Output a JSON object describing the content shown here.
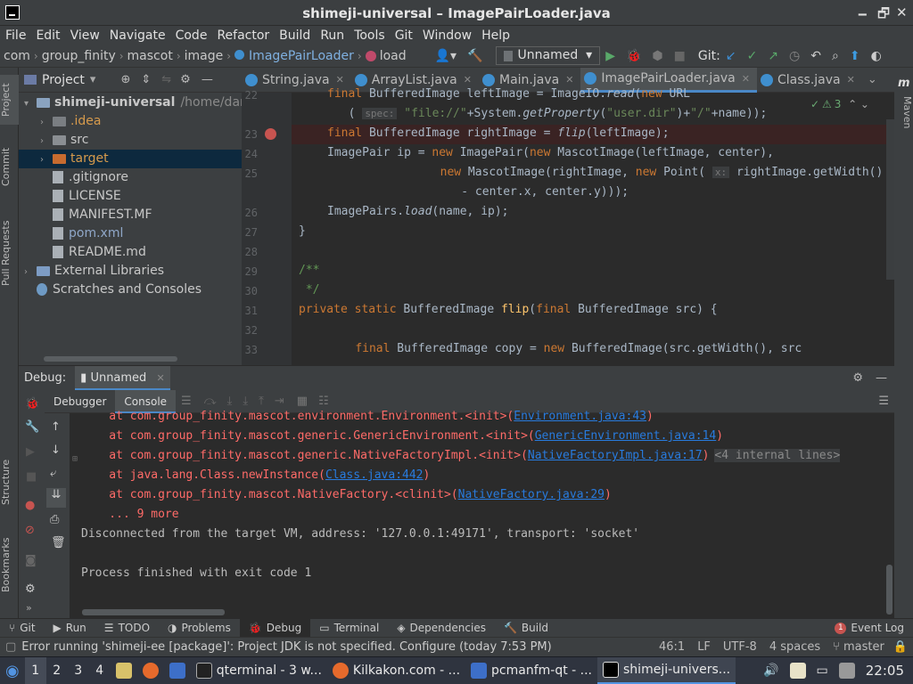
{
  "window": {
    "title": "shimeji-universal – ImagePairLoader.java"
  },
  "menu": [
    "File",
    "Edit",
    "View",
    "Navigate",
    "Code",
    "Refactor",
    "Build",
    "Run",
    "Tools",
    "Git",
    "Window",
    "Help"
  ],
  "breadcrumb": [
    "com",
    "group_finity",
    "mascot",
    "image",
    "ImagePairLoader",
    "load"
  ],
  "toolbar": {
    "run_config": "Unnamed",
    "git_label": "Git:"
  },
  "project": {
    "header": "Project",
    "items": [
      {
        "label": "shimeji-universal",
        "path": "/home/dartz",
        "depth": 0,
        "type": "module"
      },
      {
        "label": ".idea",
        "depth": 1,
        "type": "folder"
      },
      {
        "label": "src",
        "depth": 1,
        "type": "folder"
      },
      {
        "label": "target",
        "depth": 1,
        "type": "folder",
        "selected": true
      },
      {
        "label": ".gitignore",
        "depth": 1,
        "type": "file"
      },
      {
        "label": "LICENSE",
        "depth": 1,
        "type": "file"
      },
      {
        "label": "MANIFEST.MF",
        "depth": 1,
        "type": "file"
      },
      {
        "label": "pom.xml",
        "depth": 1,
        "type": "file"
      },
      {
        "label": "README.md",
        "depth": 1,
        "type": "file"
      },
      {
        "label": "External Libraries",
        "depth": 0,
        "type": "lib"
      },
      {
        "label": "Scratches and Consoles",
        "depth": 0,
        "type": "scratch"
      }
    ]
  },
  "tabs": [
    "String.java",
    "ArrayList.java",
    "Main.java",
    "ImagePairLoader.java",
    "Class.java"
  ],
  "editor": {
    "warnings": "3",
    "lines": [
      {
        "n": "22",
        "html": "<span class='kw'>final</span> BufferedImage leftImage = ImageIO.<span class='it'>read</span>(<span class='kw'>new</span> URL"
      },
      {
        "n": "",
        "html": "  ( <span class='hint'>spec:</span> <span class='st'>\"file://\"</span>+System.<span class='it'>getProperty</span>(<span class='st'>\"user.dir\"</span>)+<span class='st'>\"/\"</span>+name));"
      },
      {
        "n": "23",
        "html": "<span class='kw'>final</span> BufferedImage rightImage = <span class='it'>flip</span>(leftImage);"
      },
      {
        "n": "24",
        "html": "ImagePair ip = <span class='kw'>new</span> ImagePair(<span class='kw'>new</span> MascotImage(leftImage, center),"
      },
      {
        "n": "25",
        "html": "        <span class='kw'>new</span> MascotImage(rightImage, <span class='kw'>new</span> Point( <span class='hint'>x:</span> rightImage.getWidth()"
      },
      {
        "n": "",
        "html": "          - center.x, center.y)));"
      },
      {
        "n": "26",
        "html": "ImagePairs.<span class='it'>load</span>(name, ip);"
      },
      {
        "n": "27",
        "html": "}"
      },
      {
        "n": "28",
        "html": ""
      },
      {
        "n": "29",
        "html": "<span class='cm'>/**</span>"
      },
      {
        "n": "30",
        "html": "<span class='cm'> */</span>"
      },
      {
        "n": "31",
        "html": "<span class='kw'>private static</span> BufferedImage <span class='fn'>flip</span>(<span class='kw'>final</span> BufferedImage src) {"
      },
      {
        "n": "32",
        "html": ""
      },
      {
        "n": "33",
        "html": "    <span class='kw'>final</span> BufferedImage copy = <span class='kw'>new</span> BufferedImage(src.getWidth(), src"
      }
    ]
  },
  "debug": {
    "label": "Debug:",
    "session": "Unnamed",
    "tabs": [
      "Debugger",
      "Console"
    ]
  },
  "console": {
    "lines": [
      {
        "t": "err",
        "pre": "    at com.group_finity.mascot.environment.Environment.<init>(",
        "link": "Environment.java:43",
        "post": ")"
      },
      {
        "t": "err",
        "pre": "    at com.group_finity.mascot.generic.GenericEnvironment.<init>(",
        "link": "GenericEnvironment.java:14",
        "post": ")"
      },
      {
        "t": "err",
        "pre": "    at com.group_finity.mascot.generic.NativeFactoryImpl.<init>(",
        "link": "NativeFactoryImpl.java:17",
        "post": ")",
        "extra": "<4 internal lines>"
      },
      {
        "t": "err",
        "pre": "    at java.lang.Class.newInstance(",
        "link": "Class.java:442",
        "post": ")"
      },
      {
        "t": "err",
        "pre": "    at com.group_finity.mascot.NativeFactory.<clinit>(",
        "link": "NativeFactory.java:29",
        "post": ")"
      },
      {
        "t": "err",
        "pre": "    ... 9 more",
        "link": "",
        "post": ""
      },
      {
        "t": "out",
        "pre": "Disconnected from the target VM, address: '127.0.0.1:49171', transport: 'socket'",
        "link": "",
        "post": ""
      },
      {
        "t": "out",
        "pre": "",
        "link": "",
        "post": ""
      },
      {
        "t": "out",
        "pre": "Process finished with exit code 1",
        "link": "",
        "post": ""
      }
    ]
  },
  "bottom_tools": [
    "Git",
    "Run",
    "TODO",
    "Problems",
    "Debug",
    "Terminal",
    "Dependencies",
    "Build"
  ],
  "event_log": {
    "count": "1",
    "label": "Event Log"
  },
  "status": {
    "message": "Error running 'shimeji-ee [package]': Project JDK is not specified. Configure (today 7:53 PM)",
    "position": "46:1",
    "line_sep": "LF",
    "encoding": "UTF-8",
    "indent": "4 spaces",
    "branch": "master"
  },
  "side_tabs": {
    "left": [
      "Project",
      "Commit",
      "Pull Requests",
      "Structure",
      "Bookmarks"
    ],
    "right": [
      "Maven"
    ]
  },
  "taskbar": {
    "workspaces": [
      "1",
      "2",
      "3",
      "4"
    ],
    "windows": [
      "qterminal - 3 w...",
      "Kilkakon.com - ...",
      "pcmanfm-qt - ...",
      "shimeji-univers..."
    ],
    "clock": "22:05"
  }
}
